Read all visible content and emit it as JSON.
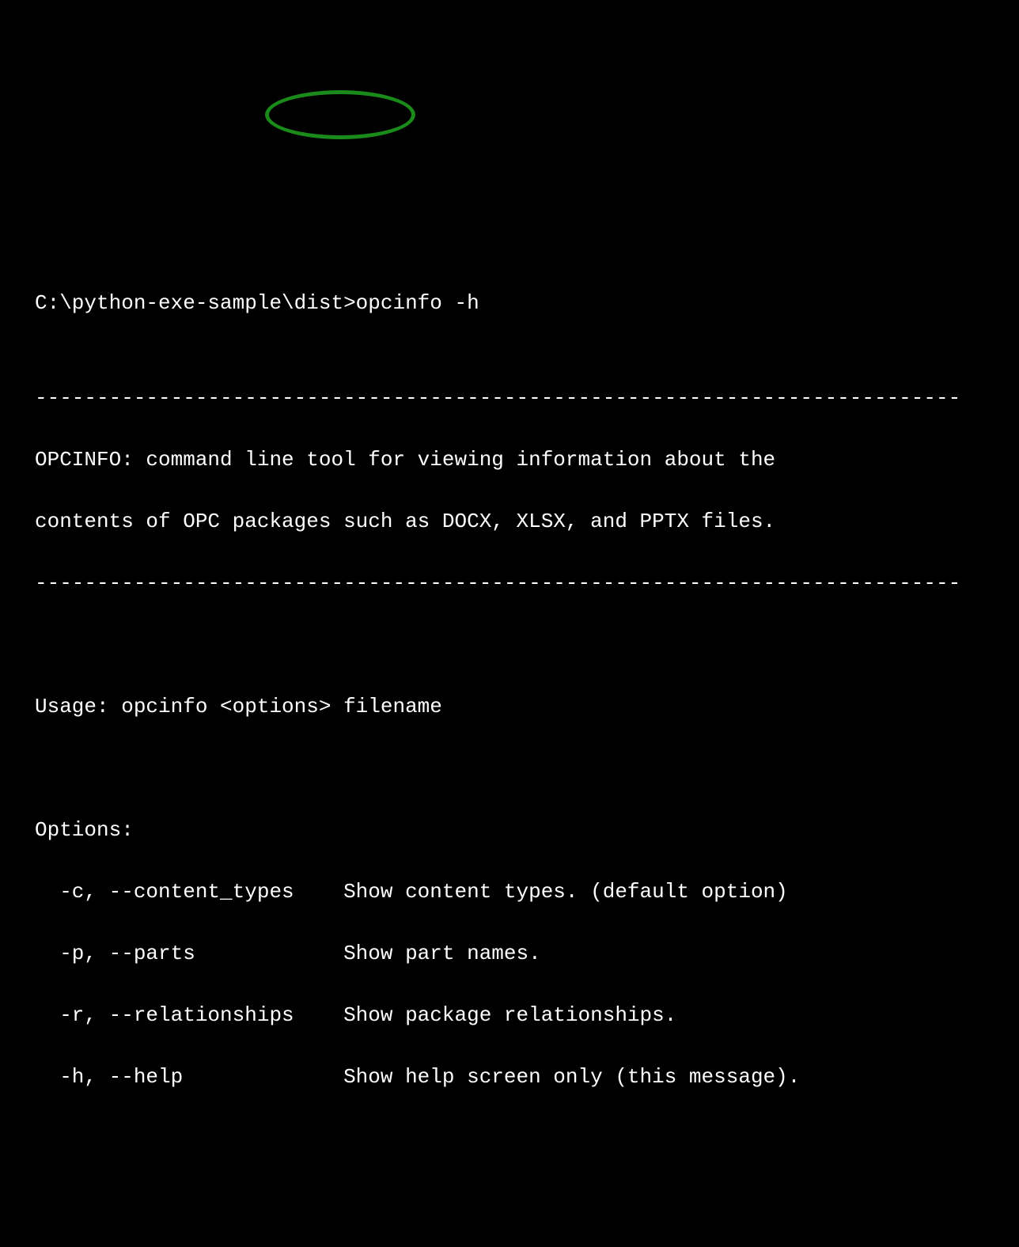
{
  "prompt": {
    "cwd": "C:\\python-exe-sample\\dist>",
    "command": "opcinfo -h"
  },
  "output": {
    "divider": "---------------------------------------------------------------------------",
    "description_line1": "OPCINFO: command line tool for viewing information about the",
    "description_line2": "contents of OPC packages such as DOCX, XLSX, and PPTX files.",
    "usage": "Usage: opcinfo <options> filename",
    "options_header": "Options:",
    "options": [
      "  -c, --content_types    Show content types. (default option)",
      "  -p, --parts            Show part names.",
      "  -r, --relationships    Show package relationships.",
      "  -h, --help             Show help screen only (this message)."
    ]
  }
}
